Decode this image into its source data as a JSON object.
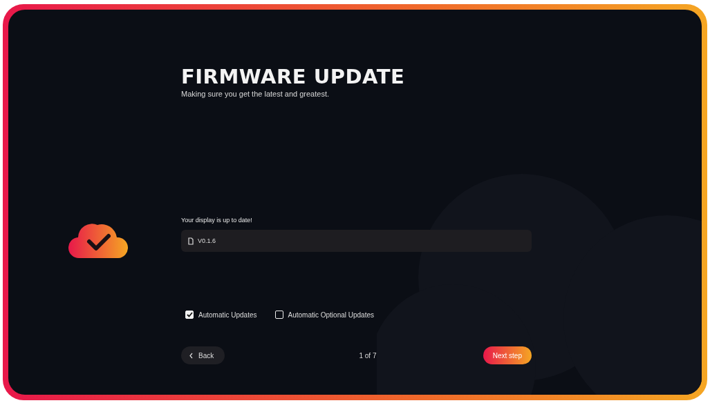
{
  "header": {
    "title": "FIRMWARE UPDATE",
    "subtitle": "Making sure you get the latest and greatest."
  },
  "status": {
    "label": "Your display is up to date!",
    "version": "V0.1.6"
  },
  "options": [
    {
      "label": "Automatic Updates",
      "checked": true
    },
    {
      "label": "Automatic Optional Updates",
      "checked": false
    }
  ],
  "footer": {
    "back": "Back",
    "pager": "1 of 7",
    "next": "Next step"
  }
}
